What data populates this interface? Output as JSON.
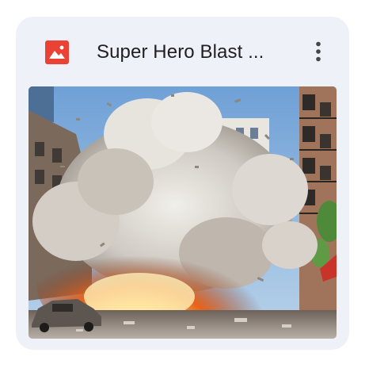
{
  "card": {
    "title": "Super Hero Blast ...",
    "file_type_icon": "image-file-icon",
    "menu_icon": "more-vert-icon",
    "thumbnail_icon": "explosion-street-scene"
  },
  "colors": {
    "card_background": "#eef1f7",
    "file_icon_red": "#ea4335",
    "title_text": "#1f1f1f",
    "menu_dots": "#444746"
  }
}
